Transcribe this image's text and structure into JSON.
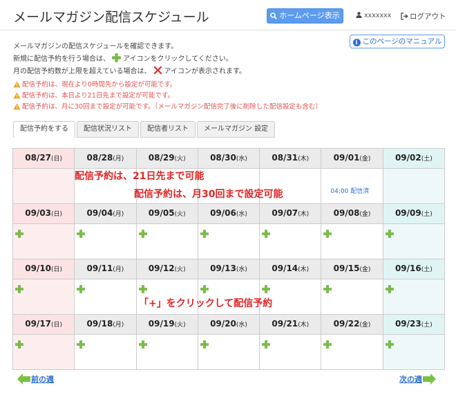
{
  "header": {
    "title": "メールマガジン配信スケジュール",
    "home_button": "ホームページ表示",
    "username": "xxxxxxx",
    "logout": "ログアウト"
  },
  "manual_button": "このページのマニュアル",
  "intro": {
    "line1": "メールマガジンの配信スケジュールを確認できます。",
    "line2_before": "新規に配信予約を行う場合は、",
    "line2_after": "アイコンをクリックしてください。",
    "line3_before": "月の配信予約数が上限を超えている場合は、",
    "line3_after": "アイコンが表示されます。"
  },
  "warnings": [
    "配信予約は、現在より0時間先から設定が可能です。",
    "配信予約は、本日より21日先まで設定が可能です。",
    "配信予約は、月に30回まで設定が可能です。（メールマガジン配信完了後に削除した配信設定も含む）"
  ],
  "tabs": [
    {
      "label": "配信予約をする",
      "active": true
    },
    {
      "label": "配信状況リスト",
      "active": false
    },
    {
      "label": "配信者リスト",
      "active": false
    },
    {
      "label": "メールマガジン 設定",
      "active": false
    }
  ],
  "calendar": {
    "weeks": [
      {
        "days": [
          {
            "date": "08/27",
            "dow": "(日)",
            "plus": false,
            "schedule": ""
          },
          {
            "date": "08/28",
            "dow": "(月)",
            "plus": false,
            "schedule": ""
          },
          {
            "date": "08/29",
            "dow": "(火)",
            "plus": false,
            "schedule": ""
          },
          {
            "date": "08/30",
            "dow": "(水)",
            "plus": false,
            "schedule": ""
          },
          {
            "date": "08/31",
            "dow": "(木)",
            "plus": false,
            "schedule": ""
          },
          {
            "date": "09/01",
            "dow": "(金)",
            "plus": false,
            "schedule": "04:00 配信済"
          },
          {
            "date": "09/02",
            "dow": "(土)",
            "plus": false,
            "schedule": ""
          }
        ]
      },
      {
        "days": [
          {
            "date": "09/03",
            "dow": "(日)",
            "plus": true,
            "schedule": ""
          },
          {
            "date": "09/04",
            "dow": "(月)",
            "plus": true,
            "schedule": ""
          },
          {
            "date": "09/05",
            "dow": "(火)",
            "plus": true,
            "schedule": ""
          },
          {
            "date": "09/06",
            "dow": "(水)",
            "plus": true,
            "schedule": ""
          },
          {
            "date": "09/07",
            "dow": "(木)",
            "plus": true,
            "schedule": ""
          },
          {
            "date": "09/08",
            "dow": "(金)",
            "plus": true,
            "schedule": ""
          },
          {
            "date": "09/09",
            "dow": "(土)",
            "plus": true,
            "schedule": ""
          }
        ]
      },
      {
        "days": [
          {
            "date": "09/10",
            "dow": "(日)",
            "plus": true,
            "schedule": ""
          },
          {
            "date": "09/11",
            "dow": "(月)",
            "plus": true,
            "schedule": ""
          },
          {
            "date": "09/12",
            "dow": "(火)",
            "plus": true,
            "schedule": ""
          },
          {
            "date": "09/13",
            "dow": "(水)",
            "plus": true,
            "schedule": ""
          },
          {
            "date": "09/14",
            "dow": "(木)",
            "plus": true,
            "schedule": ""
          },
          {
            "date": "09/15",
            "dow": "(金)",
            "plus": true,
            "schedule": ""
          },
          {
            "date": "09/16",
            "dow": "(土)",
            "plus": true,
            "schedule": ""
          }
        ]
      },
      {
        "days": [
          {
            "date": "09/17",
            "dow": "(日)",
            "plus": true,
            "schedule": ""
          },
          {
            "date": "09/18",
            "dow": "(月)",
            "plus": true,
            "schedule": ""
          },
          {
            "date": "09/19",
            "dow": "(火)",
            "plus": true,
            "schedule": ""
          },
          {
            "date": "09/20",
            "dow": "(水)",
            "plus": true,
            "schedule": ""
          },
          {
            "date": "09/21",
            "dow": "(木)",
            "plus": true,
            "schedule": ""
          },
          {
            "date": "09/22",
            "dow": "(金)",
            "plus": true,
            "schedule": ""
          },
          {
            "date": "09/23",
            "dow": "(土)",
            "plus": true,
            "schedule": ""
          }
        ]
      }
    ]
  },
  "callouts": {
    "c1": "配信予約は、21日先まで可能",
    "c2": "配信予約は、月30回まで設定可能",
    "c3": "「+」をクリックして配信予約"
  },
  "nav": {
    "prev": "前の週",
    "next": "次の週"
  },
  "colors": {
    "accent": "#5b9cf0",
    "plus": "#7ac142",
    "x": "#e03030",
    "warning": "#e25050",
    "callout": "#e02424",
    "sunday_bg": "#fce3e3",
    "saturday_bg": "#e0f4f4"
  }
}
